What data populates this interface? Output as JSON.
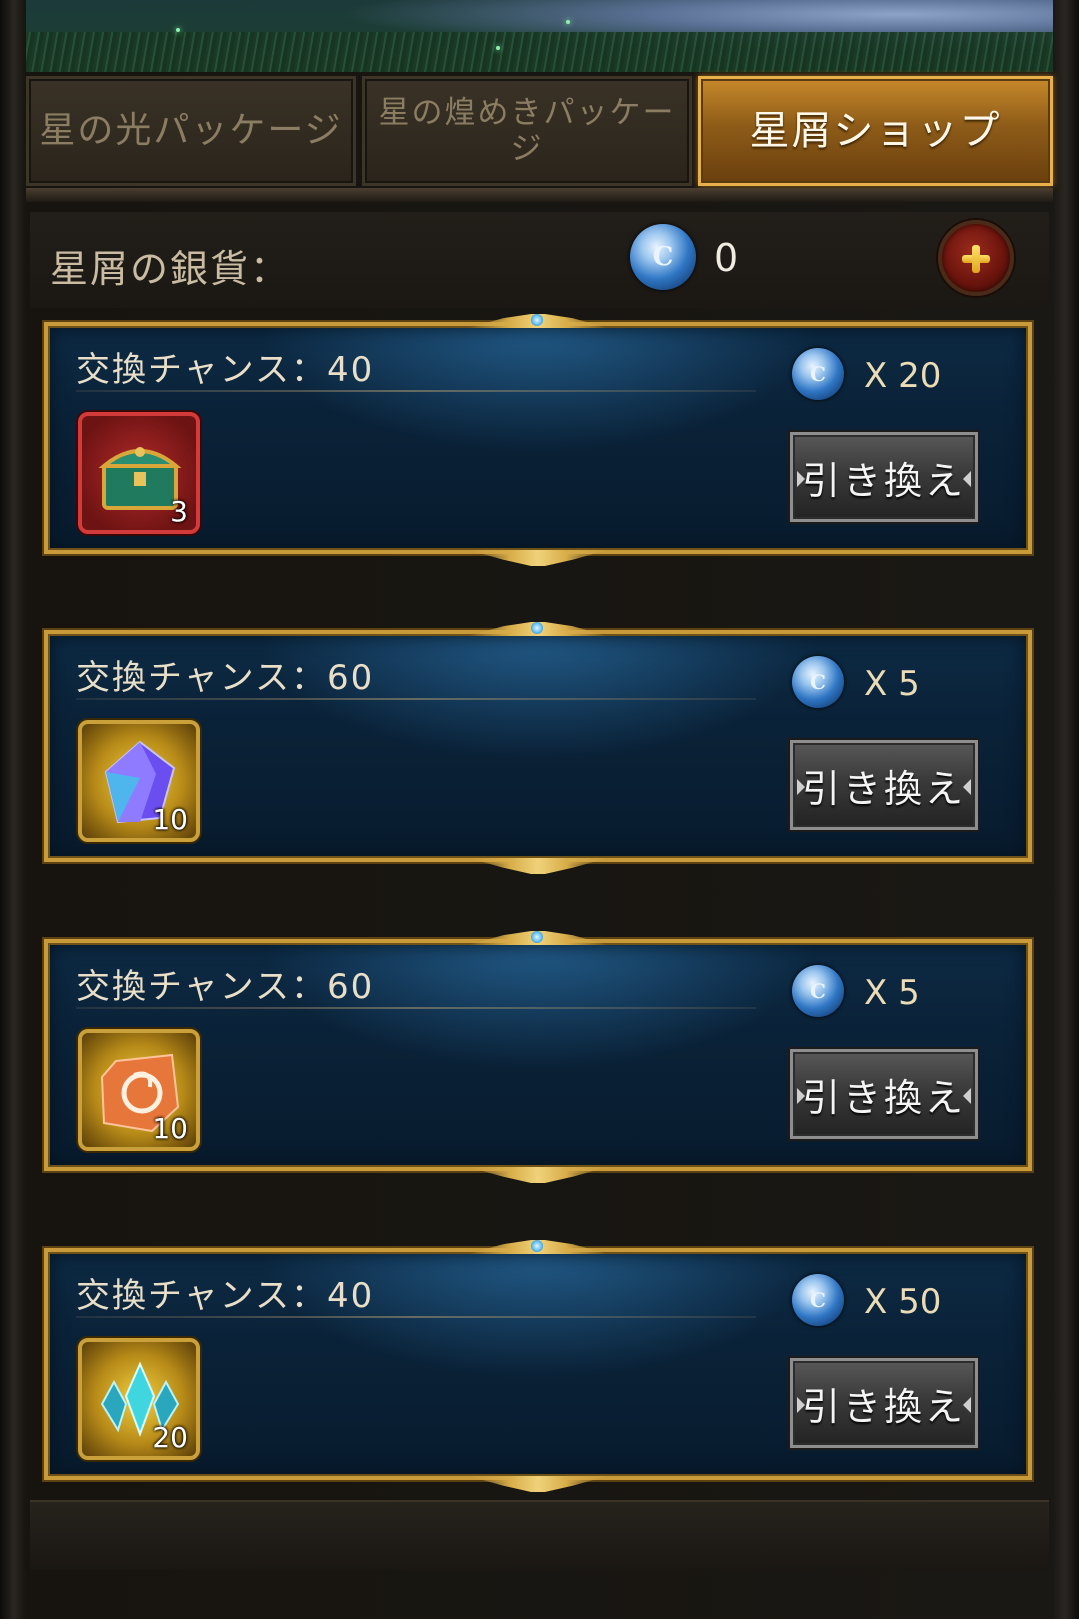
{
  "tabs": [
    {
      "label": "星の光パッケージ",
      "active": false
    },
    {
      "label": "星の煌めきパッケージ",
      "active": false
    },
    {
      "label": "星屑ショップ",
      "active": true
    }
  ],
  "currency": {
    "label": "星屑の銀貨：",
    "icon": "star-silver-coin-icon",
    "value": "0",
    "add_icon": "plus-icon"
  },
  "items": [
    {
      "chances_label": "交換チャンス：40",
      "cost": "X 20",
      "quantity": "3",
      "icon": "treasure-chest-icon",
      "button": "引き換え"
    },
    {
      "chances_label": "交換チャンス：60",
      "cost": "X 5",
      "quantity": "10",
      "icon": "purple-crystal-icon",
      "button": "引き換え"
    },
    {
      "chances_label": "交換チャンス：60",
      "cost": "X 5",
      "quantity": "10",
      "icon": "orange-rune-stone-icon",
      "button": "引き換え"
    },
    {
      "chances_label": "交換チャンス：40",
      "cost": "X 50",
      "quantity": "20",
      "icon": "cyan-emblem-icon",
      "button": "引き換え"
    }
  ],
  "colors": {
    "gold_border": "#c99a3a",
    "active_tab": "#c7882a",
    "card_bg": "#0a2238"
  }
}
